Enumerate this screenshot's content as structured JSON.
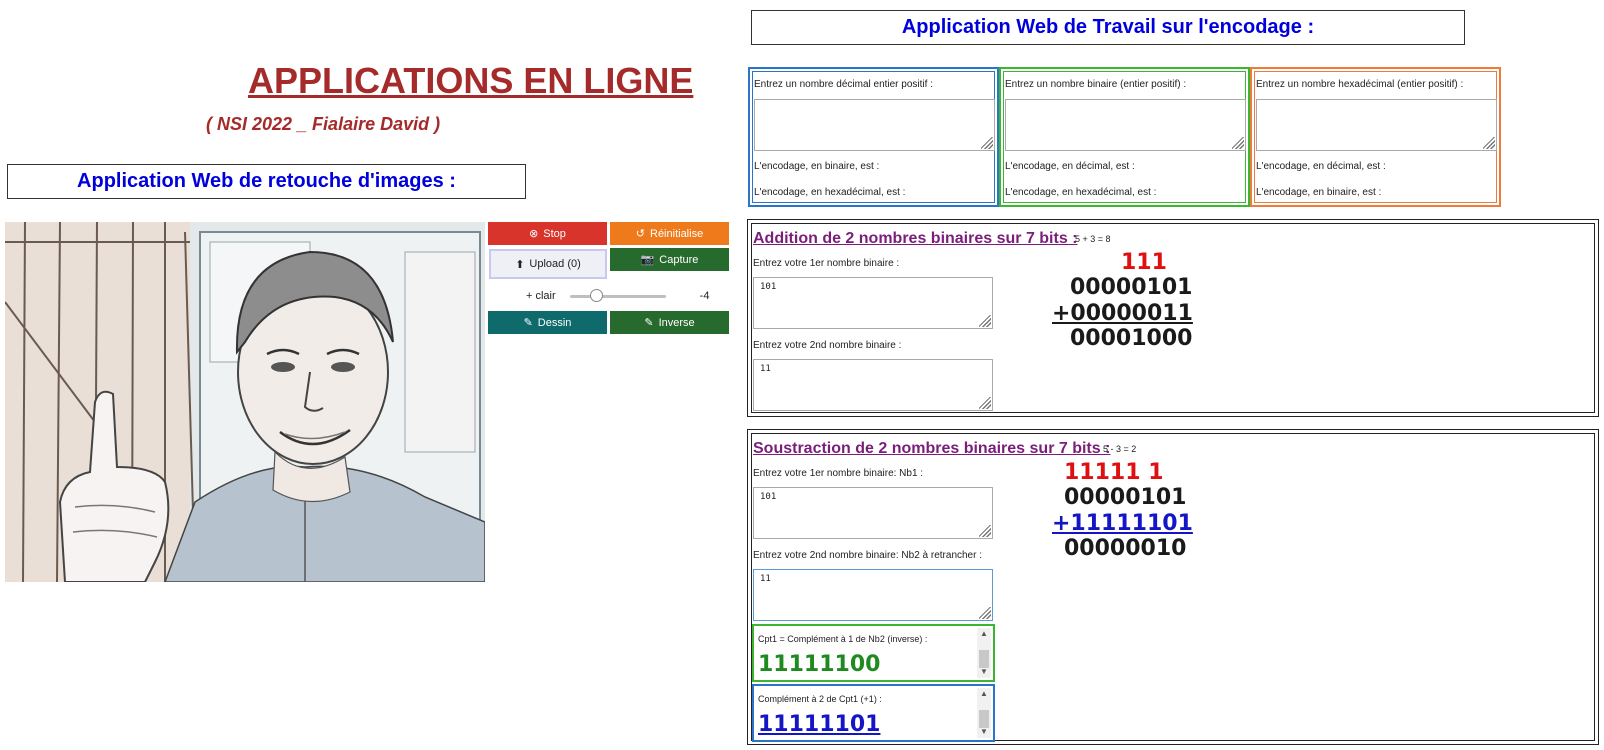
{
  "header": {
    "title": "APPLICATIONS EN LIGNE",
    "subtitle": "( NSI 2022 _ Fialaire David )",
    "image_app_title": "Application Web de retouche d'images :",
    "encoding_app_title": "Application Web de Travail sur l'encodage :"
  },
  "image_app": {
    "buttons": {
      "stop": "Stop",
      "reset": "Réinitialise",
      "upload": "Upload (0)",
      "capture": "Capture",
      "draw": "Dessin",
      "inverse": "Inverse"
    },
    "slider": {
      "label": "+ clair",
      "value": "-4",
      "level": 0.25
    }
  },
  "encoding": {
    "decimal": {
      "prompt": "Entrez un nombre décimal entier positif :",
      "value": "",
      "out1": "L'encodage, en binaire, est :",
      "out2": "L'encodage, en hexadécimal, est :",
      "color": "#2a74c9"
    },
    "binary": {
      "prompt": "Entrez un nombre binaire (entier positif) :",
      "value": "",
      "out1": "L'encodage, en décimal, est :",
      "out2": "L'encodage, en hexadécimal, est :",
      "color": "#3cb531"
    },
    "hex": {
      "prompt": "Entrez un nombre hexadécimal (entier positif) :",
      "value": "",
      "out1": "L'encodage, en décimal, est :",
      "out2": "L'encodage, en binaire, est :",
      "color": "#ee7a3c"
    }
  },
  "addition": {
    "title": "Addition de 2 nombres binaires sur 7 bits :",
    "hint": "5 + 3 = 8",
    "label1": "Entrez votre 1er nombre binaire :",
    "value1": "101",
    "label2": "Entrez votre 2nd nombre binaire :",
    "value2": "11",
    "carry": "111",
    "line1": "00000101",
    "line2": "+00000011",
    "result": "00001000"
  },
  "subtraction": {
    "title": "Soustraction de 2 nombres binaires sur 7 bits :",
    "hint": "5 - 3 = 2",
    "label1": "Entrez votre 1er nombre binaire: Nb1 :",
    "value1": "101",
    "label2": "Entrez votre 2nd nombre binaire: Nb2 à retrancher :",
    "value2": "11",
    "carry": "11111  1",
    "line1": "00000101",
    "line2": "+11111101",
    "result": "00000010",
    "cpt1_label": "Cpt1 = Complément à 1 de Nb2 (inverse) :",
    "cpt1_value": "11111100",
    "cpt2_label": "Complément à 2 de Cpt1 (+1) :",
    "cpt2_value": "11111101"
  },
  "colors": {
    "title_red": "#a52a2a",
    "heading_blue": "#0000dd",
    "op_title_purple": "#7b1e7b",
    "carry_red": "#e01010",
    "cpt1_green": "#1f8a1f",
    "cpt2_blue": "#1515c8"
  },
  "icons": {
    "stop": "circle-x-icon",
    "reset": "undo-icon",
    "upload": "upload-icon",
    "capture": "camera-icon",
    "draw": "pencil-icon",
    "inverse": "pencil-icon"
  }
}
